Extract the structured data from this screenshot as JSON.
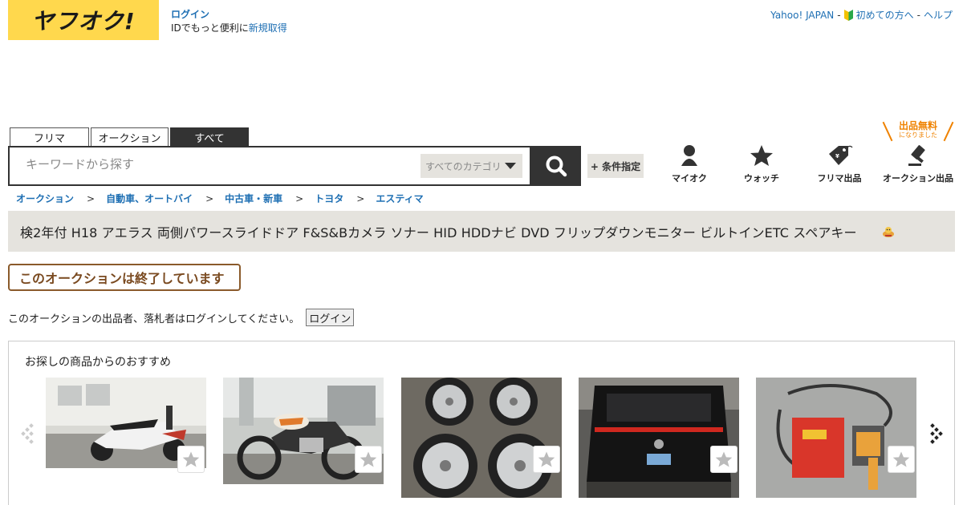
{
  "header": {
    "logo_text": "ヤフオク!",
    "login_label": "ログイン",
    "login_sub_prefix": "IDでもっと便利に",
    "signup_label": "新規取得",
    "top_links": {
      "yahoo_japan": "Yahoo! JAPAN",
      "first_time": "初めての方へ",
      "help": "ヘルプ",
      "sep": "-"
    }
  },
  "search": {
    "tabs": [
      "フリマ",
      "オークション",
      "すべて"
    ],
    "placeholder": "キーワードから探す",
    "category": "すべてのカテゴリ",
    "condition_label": "+ 条件指定"
  },
  "nav": {
    "myauc": "マイオク",
    "watch": "ウォッチ",
    "flea_listing": "フリマ出品",
    "auction_listing": "オークション出品",
    "free_badge_main": "出品無料",
    "free_badge_sub": "になりました"
  },
  "breadcrumb": [
    "オークション",
    "自動車、オートバイ",
    "中古車・新車",
    "トヨタ",
    "エスティマ"
  ],
  "breadcrumb_sep": ">",
  "item": {
    "title": "検2年付 H18 アエラス 両側パワースライドドア F&S&Bカメラ ソナー HID HDDナビ DVD フリップダウンモニター ビルトインETC スペアキー"
  },
  "status": {
    "ended_label": "このオークションは終了しています",
    "login_note": "このオークションの出品者、落札者はログインしてください。",
    "login_button": "ログイン"
  },
  "recommend": {
    "title": "お探しの商品からのおすすめ",
    "items": [
      {
        "image": "scooter-photo"
      },
      {
        "image": "motorcycle-photo"
      },
      {
        "image": "wheels-photo"
      },
      {
        "image": "minivan-rear-photo"
      },
      {
        "image": "welder-photo"
      }
    ]
  },
  "colors": {
    "brand_yellow": "#ffd84d",
    "link_blue": "#1e6fb3",
    "dark": "#333333",
    "ended_brown": "#8a5a2b",
    "badge_orange": "#ef8200",
    "title_bg": "#e5e3de"
  }
}
